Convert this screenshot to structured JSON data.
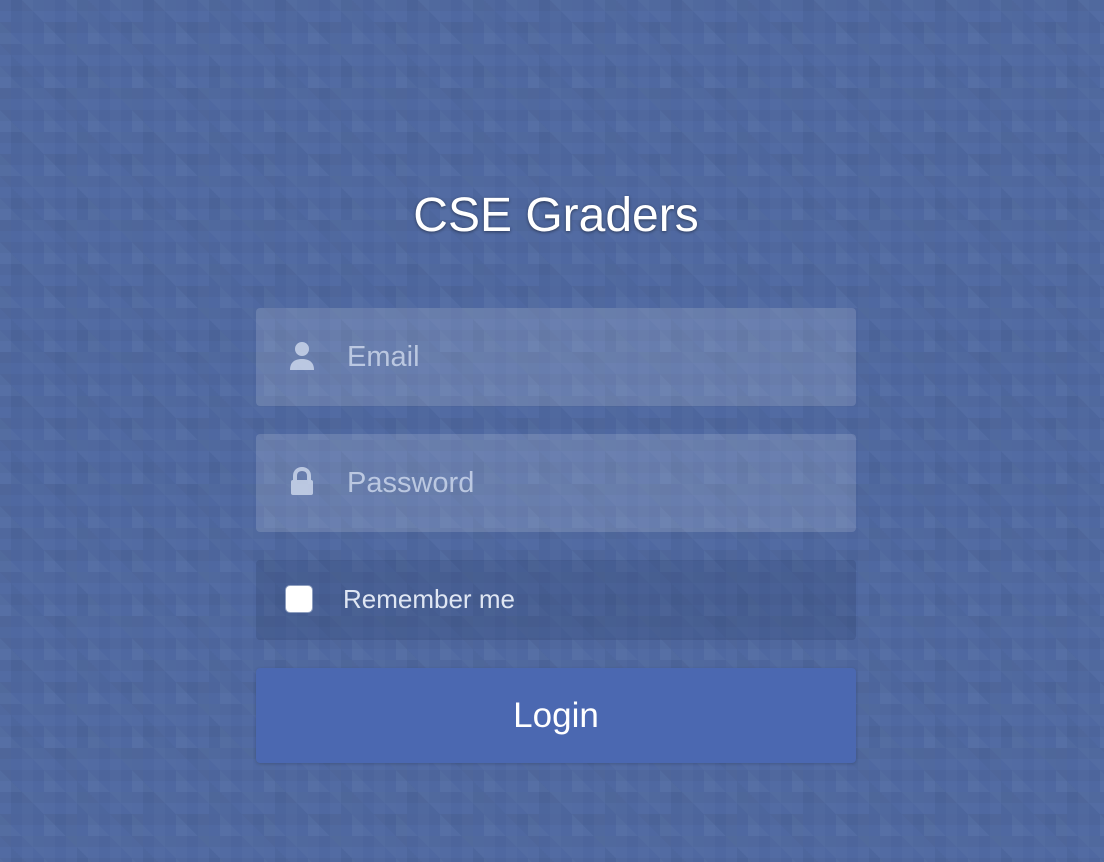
{
  "app": {
    "title": "CSE Graders"
  },
  "form": {
    "email": {
      "value": "",
      "placeholder": "Email",
      "icon": "user-icon"
    },
    "password": {
      "value": "",
      "placeholder": "Password",
      "icon": "lock-icon"
    },
    "remember": {
      "label": "Remember me",
      "checked": false
    },
    "login": {
      "label": "Login"
    }
  },
  "colors": {
    "background": "#4f68a1",
    "input_background": "rgba(255,255,255,0.14)",
    "button_background": "#4b68b1",
    "text": "#ffffff",
    "placeholder": "#d2dcf0"
  }
}
